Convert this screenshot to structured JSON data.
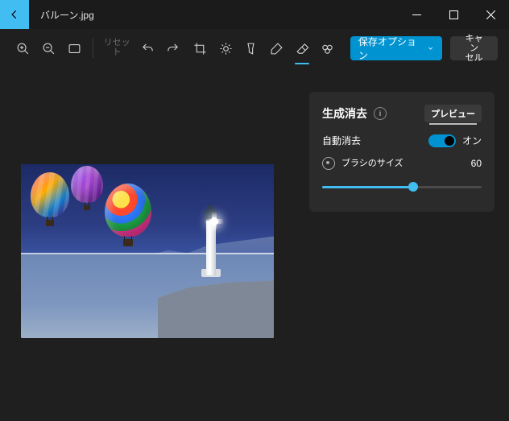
{
  "titlebar": {
    "filename": "バルーン.jpg"
  },
  "toolbar": {
    "reset_label": "リセット",
    "save_label": "保存オプション",
    "cancel_label": "キャン\nセル"
  },
  "panel": {
    "title": "生成消去",
    "preview_label": "プレビュー",
    "auto_erase_label": "自動消去",
    "auto_erase_state": "オン",
    "brush_size_label": "ブラシのサイズ",
    "brush_size_value": "60"
  }
}
